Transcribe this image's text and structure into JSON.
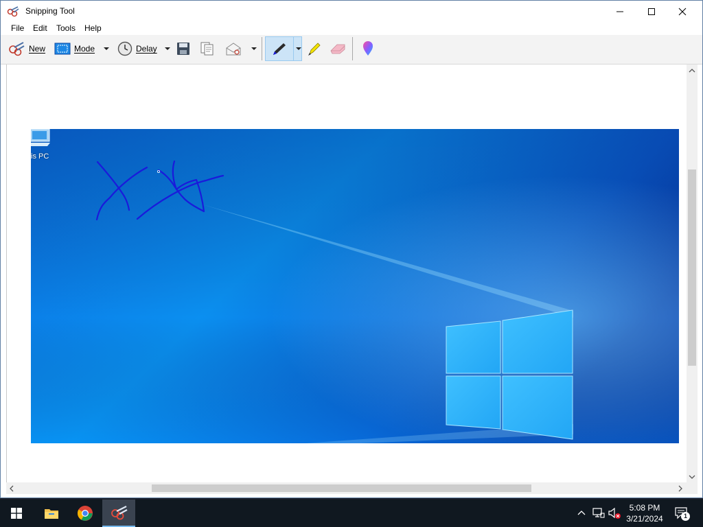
{
  "window": {
    "title": "Snipping Tool"
  },
  "menu": {
    "file": "File",
    "edit": "Edit",
    "tools": "Tools",
    "help": "Help"
  },
  "toolbar": {
    "new_label": "New",
    "mode_label": "Mode",
    "delay_label": "Delay"
  },
  "snip": {
    "desktop_icon_label": "is PC"
  },
  "clock": {
    "time": "5:08 PM",
    "date": "3/21/2024"
  },
  "notifications": {
    "count": "1"
  },
  "colors": {
    "pen": "#1a1adb",
    "accent": "#0078d7",
    "taskbar": "#101820"
  }
}
